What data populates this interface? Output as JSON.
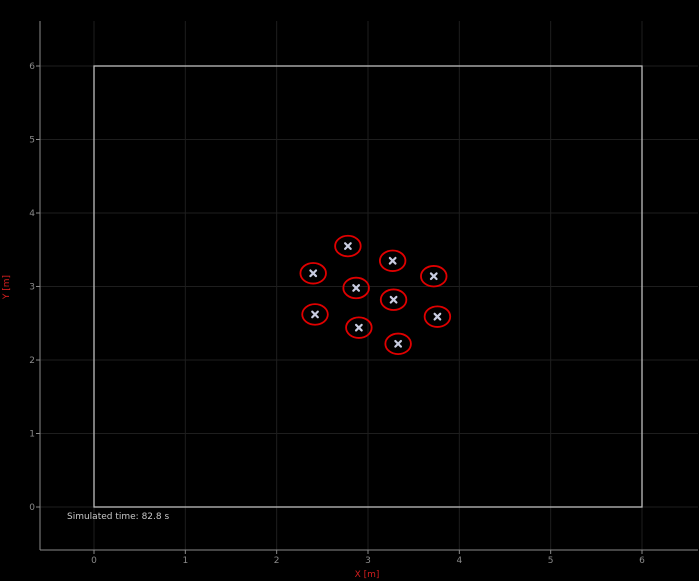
{
  "chart_data": {
    "type": "scatter",
    "xlabel": "X [m]",
    "ylabel": "Y [m]",
    "xlim": [
      -0.6,
      6.6
    ],
    "ylim": [
      -0.6,
      6.6
    ],
    "xticks": [
      "0",
      "1",
      "2",
      "3",
      "4",
      "5",
      "6"
    ],
    "yticks": [
      "0",
      "1",
      "2",
      "3",
      "4",
      "5",
      "6"
    ],
    "grid": true,
    "arena": {
      "x": [
        0,
        6
      ],
      "y": [
        0,
        6
      ]
    },
    "annotation": "Simulated time: 82.8 s",
    "robot_radius": 0.14,
    "points": [
      {
        "x": 2.78,
        "y": 3.55
      },
      {
        "x": 3.27,
        "y": 3.35
      },
      {
        "x": 2.4,
        "y": 3.18
      },
      {
        "x": 3.72,
        "y": 3.14
      },
      {
        "x": 2.87,
        "y": 2.98
      },
      {
        "x": 3.28,
        "y": 2.82
      },
      {
        "x": 2.42,
        "y": 2.62
      },
      {
        "x": 3.76,
        "y": 2.59
      },
      {
        "x": 2.9,
        "y": 2.44
      },
      {
        "x": 3.33,
        "y": 2.22
      }
    ],
    "colors": {
      "background": "#000000",
      "axis": "#8a8a8a",
      "grid": "#1e1e1e",
      "arena": "#bebebe",
      "robot_ring": "#e00000",
      "marker": "#c8cce0",
      "axis_label": "#d21e1e"
    }
  }
}
